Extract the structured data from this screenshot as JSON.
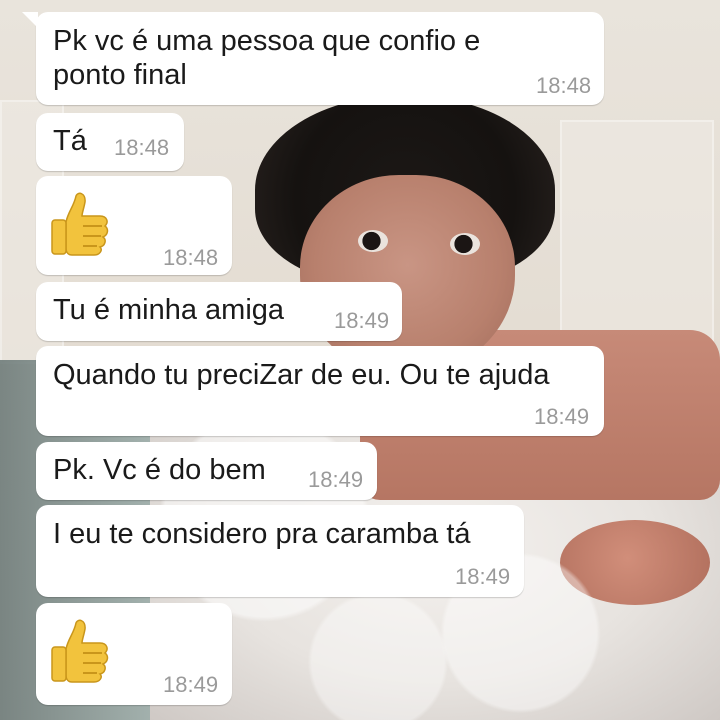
{
  "messages": [
    {
      "text": "Pk vc é uma pessoa que confio e\nponto final",
      "time": "18:48"
    },
    {
      "text": "Tá",
      "time": "18:48"
    },
    {
      "emoji": "thumbs-up",
      "time": "18:48"
    },
    {
      "text": "Tu é minha amiga",
      "time": "18:49"
    },
    {
      "text": "Quando tu preciZar de eu. Ou te ajuda",
      "time": "18:49"
    },
    {
      "text": "Pk. Vc é do bem",
      "time": "18:49"
    },
    {
      "text": "I eu te considero pra caramba tá",
      "time": "18:49"
    },
    {
      "emoji": "thumbs-up",
      "time": "18:49"
    }
  ],
  "colors": {
    "bubble": "#ffffff",
    "timestamp": "#9a9a9a",
    "thumb_emoji": "#f2c33d"
  }
}
